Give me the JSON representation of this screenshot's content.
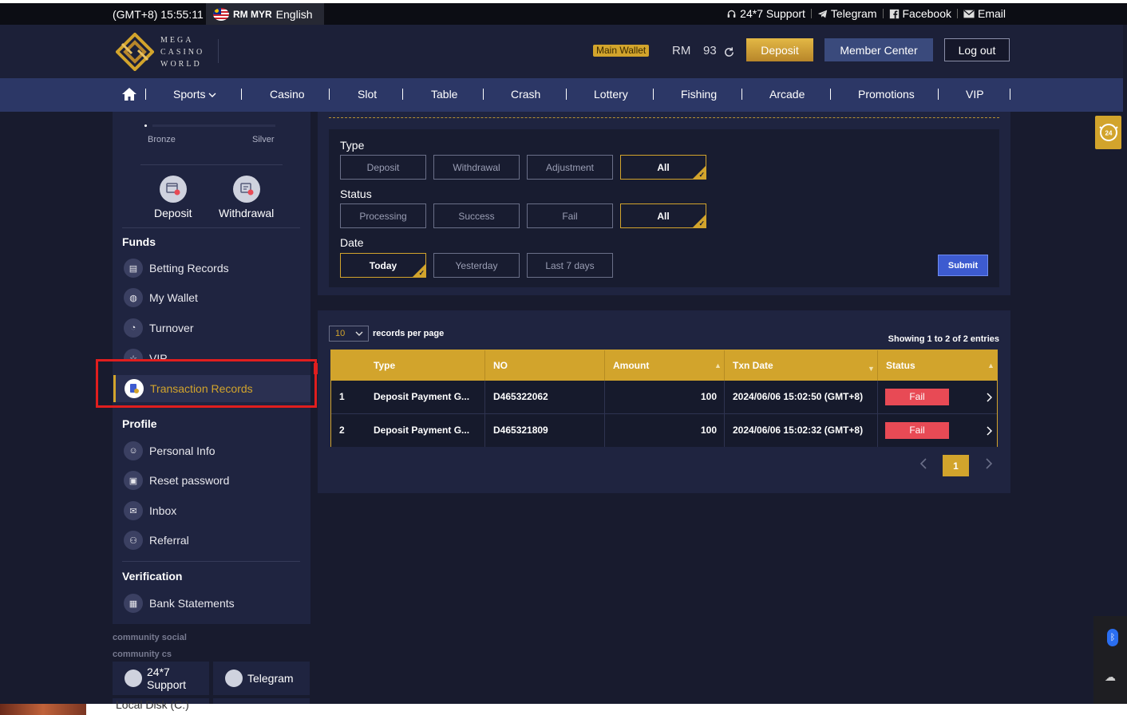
{
  "topbar": {
    "time": "(GMT+8) 15:55:11",
    "currency": "RM MYR",
    "language": "English",
    "links": [
      {
        "label": "24*7 Support",
        "icon": "headset-icon"
      },
      {
        "label": "Telegram",
        "icon": "telegram-icon"
      },
      {
        "label": "Facebook",
        "icon": "facebook-icon"
      },
      {
        "label": "Email",
        "icon": "email-icon"
      }
    ]
  },
  "header": {
    "logo_lines": [
      "MEGA",
      "CASINO",
      "WORLD"
    ],
    "wallet_label": "Main Wallet",
    "currency": "RM",
    "balance": "93",
    "deposit_label": "Deposit",
    "member_label": "Member Center",
    "logout_label": "Log out"
  },
  "nav": {
    "items": [
      "Sports",
      "Casino",
      "Slot",
      "Table",
      "Crash",
      "Lottery",
      "Fishing",
      "Arcade",
      "Promotions",
      "VIP"
    ]
  },
  "sidebar": {
    "tiers": [
      "Bronze",
      "Silver"
    ],
    "quick_actions": [
      {
        "label": "Deposit",
        "icon": "deposit-icon"
      },
      {
        "label": "Withdrawal",
        "icon": "withdrawal-icon"
      }
    ],
    "sections": [
      {
        "title": "Funds",
        "items": [
          "Betting Records",
          "My Wallet",
          "Turnover",
          "VIP",
          "Transaction Records"
        ]
      },
      {
        "title": "Profile",
        "items": [
          "Personal Info",
          "Reset password",
          "Inbox",
          "Referral"
        ]
      },
      {
        "title": "Verification",
        "items": [
          "Bank Statements"
        ]
      }
    ],
    "active_item": "Transaction Records",
    "community_social": "community social",
    "community_cs": "community cs",
    "social_buttons": [
      "24*7",
      "Support",
      "Telegram"
    ]
  },
  "filters": {
    "type_label": "Type",
    "type_options": [
      "Deposit",
      "Withdrawal",
      "Adjustment",
      "All"
    ],
    "type_selected": "All",
    "status_label": "Status",
    "status_options": [
      "Processing",
      "Success",
      "Fail",
      "All"
    ],
    "status_selected": "All",
    "date_label": "Date",
    "date_options": [
      "Today",
      "Yesterday",
      "Last 7 days"
    ],
    "date_selected": "Today",
    "submit_label": "Submit"
  },
  "records": {
    "per_page_value": "10",
    "per_page_label": "records per page",
    "showing": "Showing 1 to 2 of 2 entries",
    "columns": [
      "Type",
      "NO",
      "Amount",
      "Txn Date",
      "Status"
    ],
    "rows": [
      {
        "index": "1",
        "type": "Deposit Payment G...",
        "no": "D465322062",
        "amount": "100",
        "date": "2024/06/06 15:02:50 (GMT+8)",
        "status": "Fail"
      },
      {
        "index": "2",
        "type": "Deposit Payment G...",
        "no": "D465321809",
        "amount": "100",
        "date": "2024/06/06 15:02:32 (GMT+8)",
        "status": "Fail"
      }
    ],
    "current_page": "1"
  },
  "misc": {
    "support_float_text": "24",
    "taskbar_text": "Local Disk (C:)"
  },
  "colors": {
    "gold": "#d2a42c",
    "fail_red": "#e84a55",
    "nav_blue": "#2c3766",
    "submit_blue": "#3d5bd0"
  }
}
